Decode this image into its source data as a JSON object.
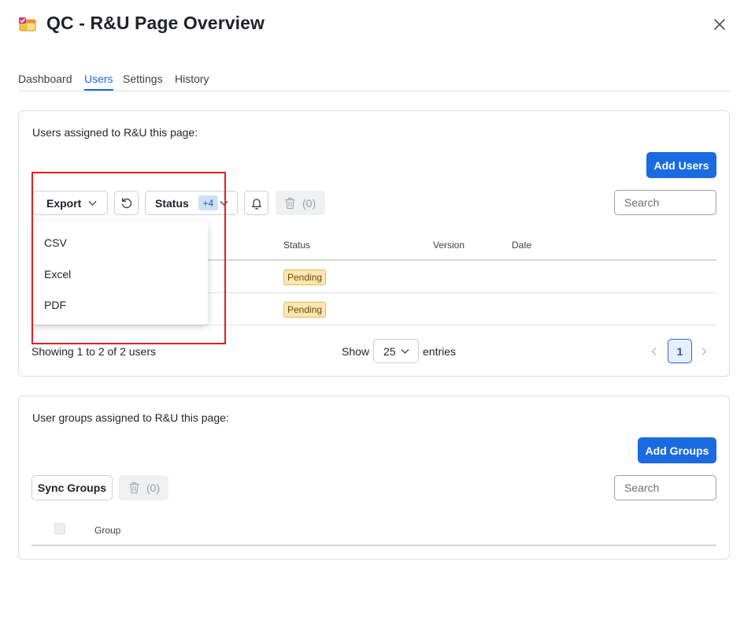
{
  "header": {
    "title": "QC - R&U Page Overview",
    "app_icon": "calendar-check-icon",
    "close_icon": "close-icon"
  },
  "tabs": [
    {
      "label": "Dashboard",
      "active": false
    },
    {
      "label": "Users",
      "active": true
    },
    {
      "label": "Settings",
      "active": false
    },
    {
      "label": "History",
      "active": false
    }
  ],
  "users_section": {
    "label": "Users assigned to R&U this page:",
    "add_button": "Add Users",
    "export_button": "Export",
    "status_button": "Status",
    "status_badge": "+4",
    "delete_count": "(0)",
    "search_placeholder": "Search",
    "columns": [
      "Status",
      "Version",
      "Date"
    ],
    "rows": [
      {
        "status": "Pending",
        "version": "",
        "date": ""
      },
      {
        "status": "Pending",
        "version": "",
        "date": ""
      }
    ],
    "footer": {
      "showing": "Showing 1 to 2 of 2 users",
      "show_label": "Show",
      "page_size": "25",
      "entries_label": "entries",
      "current_page": "1"
    },
    "export_menu": [
      "CSV",
      "Excel",
      "PDF"
    ]
  },
  "groups_section": {
    "label": "User groups assigned to R&U this page:",
    "add_button": "Add Groups",
    "sync_button": "Sync Groups",
    "delete_count": "(0)",
    "search_placeholder": "Search",
    "columns": [
      "Group"
    ]
  },
  "colors": {
    "accent": "#1a6ae0",
    "pending_bg": "#fde8b4",
    "highlight": "#e02020"
  }
}
